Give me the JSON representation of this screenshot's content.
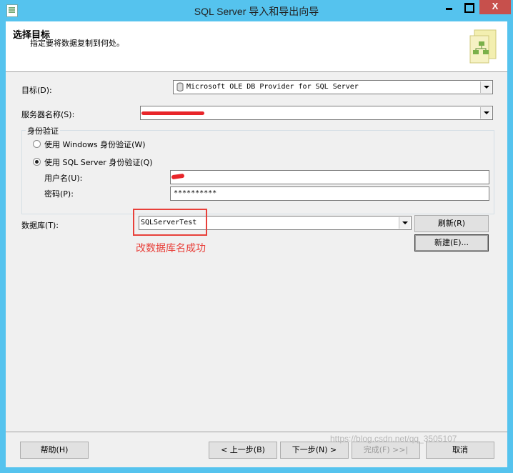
{
  "window": {
    "title": "SQL Server 导入和导出向导",
    "minimize_label": "",
    "maximize_label": "",
    "close_label": "X"
  },
  "header": {
    "title": "选择目标",
    "subtitle": "指定要将数据复制到何处。",
    "icon": "wizard-target-icon"
  },
  "form": {
    "destination_label": "目标(D):",
    "destination_value": "Microsoft OLE DB Provider for SQL Server",
    "server_label": "服务器名称(S):",
    "server_value": "",
    "auth_group_label": "身份验证",
    "windows_auth_label": "使用 Windows 身份验证(W)",
    "sql_auth_label": "使用 SQL Server 身份验证(Q)",
    "selected_auth": "sql",
    "username_label": "用户名(U):",
    "username_value": "",
    "password_label": "密码(P):",
    "password_value": "**********",
    "database_label": "数据库(T):",
    "database_value": "SQLServerTest",
    "refresh_label": "刷新(R)",
    "new_label": "新建(E)..."
  },
  "annotation": {
    "text": "改数据库名成功",
    "color": "#e8403a"
  },
  "footer": {
    "help_label": "帮助(H)",
    "back_label": "< 上一步(B)",
    "next_label": "下一步(N) >",
    "finish_label": "完成(F) >>|",
    "cancel_label": "取消"
  },
  "watermark": "https://blog.csdn.net/qq_3505107",
  "colors": {
    "titlebar": "#55c3ee",
    "close_button": "#c7504c",
    "redaction": "#e8252a"
  }
}
